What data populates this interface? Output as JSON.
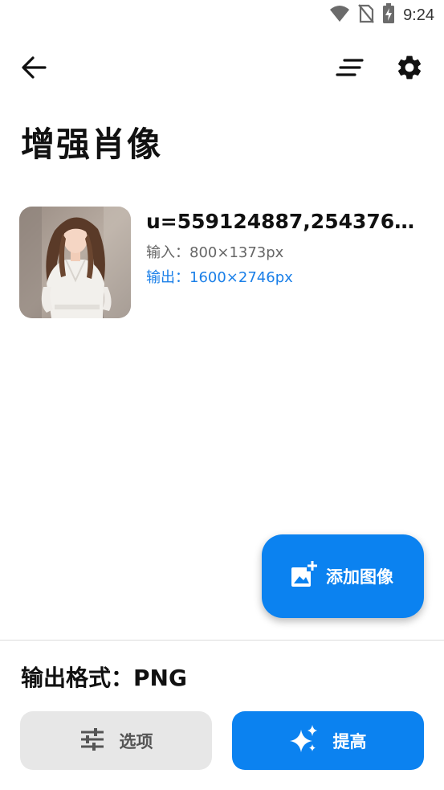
{
  "status_bar": {
    "time": "9:24",
    "icons": [
      "wifi-icon",
      "no-sim-icon",
      "battery-charging-icon"
    ]
  },
  "app_bar": {
    "back_icon": "arrow-back-icon",
    "sort_icon": "sort-lines-icon",
    "settings_icon": "gear-icon"
  },
  "page": {
    "title": "增强肖像"
  },
  "image_item": {
    "file_name": "u=559124887,2543760…",
    "input_label": "输入：800×1373px",
    "output_label": "输出：1600×2746px"
  },
  "fab": {
    "icon": "add-photo-icon",
    "label": "添加图像"
  },
  "bottom": {
    "format_label": "输出格式：PNG",
    "options_button": {
      "icon": "sliders-icon",
      "label": "选项"
    },
    "enhance_button": {
      "icon": "sparkles-icon",
      "label": "提高"
    }
  },
  "colors": {
    "accent": "#0b82f0",
    "output_text": "#1a7fe8",
    "secondary_button": "#e7e7e7"
  }
}
